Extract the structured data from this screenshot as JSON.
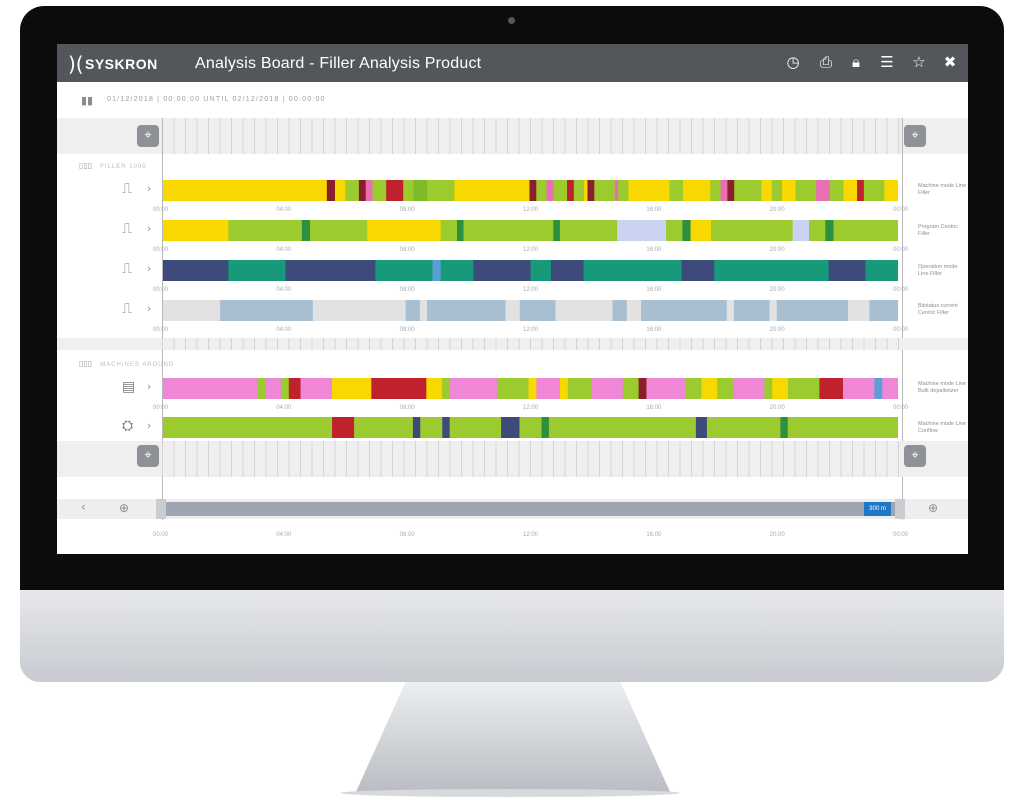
{
  "app": {
    "logo_mark": ")(",
    "logo_text": "SYSKRON",
    "title": "Analysis Board  -  Filler Analysis Product"
  },
  "toolbar_icons": [
    "clock-icon",
    "print-icon",
    "lock-icon",
    "menu-icon",
    "star-icon",
    "close-icon"
  ],
  "date_range": "01/12/2018 | 00:00:00 UNTIL 02/12/2018 | 00:00:00",
  "groups": [
    {
      "name": "FILLER 1000",
      "rows": [
        {
          "label": "Machine mode Line Filler",
          "icon": "filler-icon",
          "segments": [
            [
              "#f9d700",
              0.24
            ],
            [
              "#8b1e2b",
              0.012
            ],
            [
              "#f9d700",
              0.015
            ],
            [
              "#9ccb2f",
              0.02
            ],
            [
              "#8b1e2b",
              0.01
            ],
            [
              "#e96fb3",
              0.01
            ],
            [
              "#9ccb2f",
              0.02
            ],
            [
              "#c0222d",
              0.025
            ],
            [
              "#9ccb2f",
              0.015
            ],
            [
              "#7cbb27",
              0.02
            ],
            [
              "#9ccb2f",
              0.04
            ],
            [
              "#f9d700",
              0.11
            ],
            [
              "#8b1e2b",
              0.01
            ],
            [
              "#9ccb2f",
              0.015
            ],
            [
              "#e96fb3",
              0.01
            ],
            [
              "#9ccb2f",
              0.02
            ],
            [
              "#c0222d",
              0.01
            ],
            [
              "#9ccb2f",
              0.015
            ],
            [
              "#f9d700",
              0.005
            ],
            [
              "#8b1e2b",
              0.01
            ],
            [
              "#9ccb2f",
              0.03
            ],
            [
              "#e96fb3",
              0.005
            ],
            [
              "#9ccb2f",
              0.015
            ],
            [
              "#f9d700",
              0.06
            ],
            [
              "#9ccb2f",
              0.02
            ],
            [
              "#f9d700",
              0.04
            ],
            [
              "#9ccb2f",
              0.015
            ],
            [
              "#e96fb3",
              0.01
            ],
            [
              "#8b1e2b",
              0.01
            ],
            [
              "#9ccb2f",
              0.04
            ],
            [
              "#f9d700",
              0.015
            ],
            [
              "#9ccb2f",
              0.015
            ],
            [
              "#f9d700",
              0.02
            ],
            [
              "#9ccb2f",
              0.03
            ],
            [
              "#e96fb3",
              0.02
            ],
            [
              "#9ccb2f",
              0.02
            ],
            [
              "#f9d700",
              0.02
            ],
            [
              "#c0222d",
              0.01
            ],
            [
              "#9ccb2f",
              0.03
            ],
            [
              "#f9d700",
              0.02
            ]
          ]
        },
        {
          "label": "Program Centric Filler",
          "icon": "filler-icon",
          "segments": [
            [
              "#f9d700",
              0.08
            ],
            [
              "#9ccb2f",
              0.09
            ],
            [
              "#2e8f3e",
              0.01
            ],
            [
              "#9ccb2f",
              0.07
            ],
            [
              "#f9d700",
              0.09
            ],
            [
              "#9ccb2f",
              0.02
            ],
            [
              "#2e8f3e",
              0.008
            ],
            [
              "#9ccb2f",
              0.11
            ],
            [
              "#2e8f3e",
              0.008
            ],
            [
              "#9ccb2f",
              0.07
            ],
            [
              "#cbd3f2",
              0.06
            ],
            [
              "#9ccb2f",
              0.02
            ],
            [
              "#2e8f3e",
              0.01
            ],
            [
              "#f9d700",
              0.025
            ],
            [
              "#9ccb2f",
              0.1
            ],
            [
              "#cbd3f2",
              0.02
            ],
            [
              "#9ccb2f",
              0.02
            ],
            [
              "#2e8f3e",
              0.01
            ],
            [
              "#9ccb2f",
              0.079
            ]
          ]
        },
        {
          "label": "Operation mode Line Filler",
          "icon": "filler-icon",
          "segments": [
            [
              "#3e4a7a",
              0.08
            ],
            [
              "#17997a",
              0.07
            ],
            [
              "#3e4a7a",
              0.11
            ],
            [
              "#17997a",
              0.07
            ],
            [
              "#5aa0d6",
              0.01
            ],
            [
              "#17997a",
              0.04
            ],
            [
              "#3e4a7a",
              0.07
            ],
            [
              "#17997a",
              0.025
            ],
            [
              "#3e4a7a",
              0.04
            ],
            [
              "#17997a",
              0.12
            ],
            [
              "#3e4a7a",
              0.04
            ],
            [
              "#17997a",
              0.14
            ],
            [
              "#3e4a7a",
              0.045
            ],
            [
              "#17997a",
              0.04
            ]
          ]
        },
        {
          "label": "Bitstatus current Centric Filler",
          "icon": "filler-icon",
          "segments": [
            [
              "#e2e2e2",
              0.08
            ],
            [
              "#a8bfd2",
              0.13
            ],
            [
              "#e2e2e2",
              0.13
            ],
            [
              "#a8bfd2",
              0.02
            ],
            [
              "#e2e2e2",
              0.01
            ],
            [
              "#a8bfd2",
              0.11
            ],
            [
              "#e2e2e2",
              0.02
            ],
            [
              "#a8bfd2",
              0.05
            ],
            [
              "#e2e2e2",
              0.08
            ],
            [
              "#a8bfd2",
              0.02
            ],
            [
              "#e2e2e2",
              0.02
            ],
            [
              "#a8bfd2",
              0.12
            ],
            [
              "#e2e2e2",
              0.01
            ],
            [
              "#a8bfd2",
              0.05
            ],
            [
              "#e2e2e2",
              0.01
            ],
            [
              "#a8bfd2",
              0.1
            ],
            [
              "#e2e2e2",
              0.03
            ],
            [
              "#a8bfd2",
              0.04
            ]
          ]
        }
      ]
    },
    {
      "name": "MACHINES AROUND",
      "rows": [
        {
          "label": "Machine mode Line Bulk depalletizer",
          "icon": "depalletizer-icon",
          "segments": [
            [
              "#ef86d6",
              0.12
            ],
            [
              "#9ccb2f",
              0.01
            ],
            [
              "#ef86d6",
              0.02
            ],
            [
              "#9ccb2f",
              0.01
            ],
            [
              "#c0222d",
              0.015
            ],
            [
              "#ef86d6",
              0.04
            ],
            [
              "#f9d700",
              0.05
            ],
            [
              "#c0222d",
              0.07
            ],
            [
              "#f9d700",
              0.02
            ],
            [
              "#9ccb2f",
              0.01
            ],
            [
              "#ef86d6",
              0.06
            ],
            [
              "#9ccb2f",
              0.04
            ],
            [
              "#f9d700",
              0.01
            ],
            [
              "#ef86d6",
              0.03
            ],
            [
              "#f9d700",
              0.01
            ],
            [
              "#9ccb2f",
              0.03
            ],
            [
              "#ef86d6",
              0.04
            ],
            [
              "#9ccb2f",
              0.02
            ],
            [
              "#8b1e2b",
              0.01
            ],
            [
              "#ef86d6",
              0.05
            ],
            [
              "#9ccb2f",
              0.02
            ],
            [
              "#f9d700",
              0.02
            ],
            [
              "#9ccb2f",
              0.02
            ],
            [
              "#ef86d6",
              0.04
            ],
            [
              "#9ccb2f",
              0.01
            ],
            [
              "#f9d700",
              0.02
            ],
            [
              "#9ccb2f",
              0.04
            ],
            [
              "#c0222d",
              0.03
            ],
            [
              "#ef86d6",
              0.04
            ],
            [
              "#5aa0d6",
              0.01
            ],
            [
              "#ef86d6",
              0.02
            ]
          ]
        },
        {
          "label": "Machine mode Line Conflow",
          "icon": "conveyor-icon",
          "segments": [
            [
              "#9ccb2f",
              0.23
            ],
            [
              "#c0222d",
              0.03
            ],
            [
              "#9ccb2f",
              0.08
            ],
            [
              "#3e4a7a",
              0.01
            ],
            [
              "#9ccb2f",
              0.03
            ],
            [
              "#3e4a7a",
              0.01
            ],
            [
              "#9ccb2f",
              0.07
            ],
            [
              "#3e4a7a",
              0.025
            ],
            [
              "#9ccb2f",
              0.03
            ],
            [
              "#2e8f3e",
              0.01
            ],
            [
              "#9ccb2f",
              0.2
            ],
            [
              "#3e4a7a",
              0.015
            ],
            [
              "#9ccb2f",
              0.1
            ],
            [
              "#2e8f3e",
              0.01
            ],
            [
              "#9ccb2f",
              0.15
            ]
          ]
        }
      ]
    }
  ],
  "time_ticks": [
    "00:00",
    "04:00",
    "08:00",
    "12:00",
    "16:00",
    "20:00",
    "00:00"
  ],
  "navigator": {
    "prev_label": "‹",
    "zoom_in_left": "⊕",
    "zoom_in_right": "⊕",
    "tag": "300 m"
  }
}
